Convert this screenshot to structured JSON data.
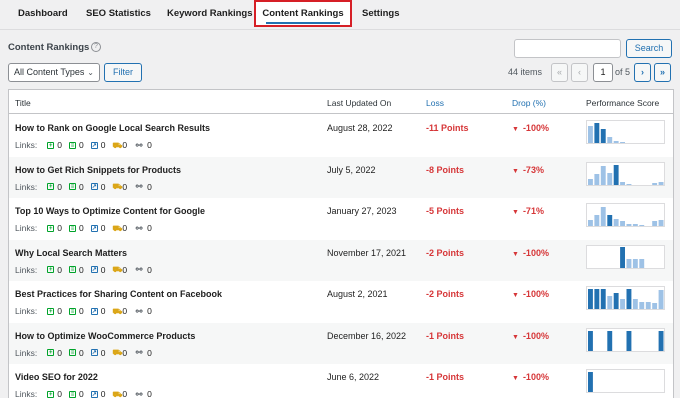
{
  "tabs": [
    {
      "label": "Dashboard",
      "active": false
    },
    {
      "label": "SEO Statistics",
      "active": false
    },
    {
      "label": "Keyword Rankings",
      "active": false
    },
    {
      "label": "Content Rankings",
      "active": true
    },
    {
      "label": "Settings",
      "active": false
    }
  ],
  "page": {
    "title": "Content Rankings",
    "help_icon": "question-circle-icon"
  },
  "search": {
    "value": "",
    "placeholder": "",
    "button_label": "Search"
  },
  "filters": {
    "content_type_selected": "All Content Types",
    "filter_button_label": "Filter"
  },
  "pagination": {
    "items_count": "44 items",
    "first": "«",
    "prev": "‹",
    "current_page": "1",
    "of_label": "of 5",
    "next": "›",
    "last": "»"
  },
  "table": {
    "columns": {
      "title": "Title",
      "last_updated": "Last Updated On",
      "loss": "Loss",
      "drop": "Drop (%)",
      "performance": "Performance Score"
    },
    "links_label": "Links:",
    "link_icons": [
      "internal-link-icon",
      "external-link-icon",
      "outbound-link-icon",
      "affiliate-link-icon",
      "chain-link-icon"
    ],
    "colors": {
      "loss": "#d63638",
      "bar_dark": "#2271b1",
      "bar_light": "#9ec2e6"
    },
    "rows": [
      {
        "title": "How to Rank on Google Local Search Results",
        "date": "August 28, 2022",
        "loss": "-11 Points",
        "drop": "-100%",
        "links": [
          "0",
          "0",
          "0",
          "0",
          "0"
        ],
        "score": [
          0.8,
          0.95,
          0.7,
          0.3,
          0.15,
          0.1,
          0,
          0,
          0,
          0,
          0,
          0
        ],
        "dark": [
          1,
          2
        ]
      },
      {
        "title": "How to Get Rich Snippets for Products",
        "date": "July 5, 2022",
        "loss": "-8 Points",
        "drop": "-73%",
        "links": [
          "0",
          "0",
          "0",
          "0",
          "0"
        ],
        "score": [
          0.3,
          0.55,
          0.9,
          0.6,
          0.95,
          0.2,
          0.1,
          0,
          0,
          0,
          0.15,
          0.2
        ],
        "dark": [
          4
        ]
      },
      {
        "title": "Top 10 Ways to Optimize Content for Google",
        "date": "January 27, 2023",
        "loss": "-5 Points",
        "drop": "-71%",
        "links": [
          "0",
          "0",
          "0",
          "0",
          "0"
        ],
        "score": [
          0.3,
          0.55,
          0.9,
          0.55,
          0.35,
          0.25,
          0.15,
          0.15,
          0.1,
          0,
          0.25,
          0.3
        ],
        "dark": [
          3
        ]
      },
      {
        "title": "Why Local Search Matters",
        "date": "November 17, 2021",
        "loss": "-2 Points",
        "drop": "-100%",
        "links": [
          "0",
          "0",
          "0",
          "0",
          "0"
        ],
        "score": [
          0,
          0,
          0,
          0,
          0,
          1.0,
          0.45,
          0.45,
          0.45,
          0,
          0,
          0
        ],
        "dark": [
          5
        ]
      },
      {
        "title": "Best Practices for Sharing Content on Facebook",
        "date": "August 2, 2021",
        "loss": "-2 Points",
        "drop": "-100%",
        "links": [
          "0",
          "0",
          "0",
          "0",
          "0"
        ],
        "score": [
          0.95,
          0.95,
          0.95,
          0.65,
          0.75,
          0.5,
          0.95,
          0.5,
          0.35,
          0.35,
          0.3,
          0.9
        ],
        "dark": [
          0,
          1,
          2,
          4,
          6
        ]
      },
      {
        "title": "How to Optimize WooCommerce Products",
        "date": "December 16, 2022",
        "loss": "-1 Points",
        "drop": "-100%",
        "links": [
          "0",
          "0",
          "0",
          "0",
          "0"
        ],
        "score": [
          0.95,
          0,
          0,
          0.95,
          0,
          0,
          0.95,
          0,
          0,
          0,
          0,
          0.95
        ],
        "dark": [
          0,
          3,
          6,
          11
        ]
      },
      {
        "title": "Video SEO for 2022",
        "date": "June 6, 2022",
        "loss": "-1 Points",
        "drop": "-100%",
        "links": [
          "0",
          "0",
          "0",
          "0",
          "0"
        ],
        "score": [
          0.95,
          0,
          0,
          0,
          0,
          0,
          0,
          0,
          0,
          0,
          0,
          0
        ],
        "dark": [
          0
        ]
      }
    ]
  }
}
